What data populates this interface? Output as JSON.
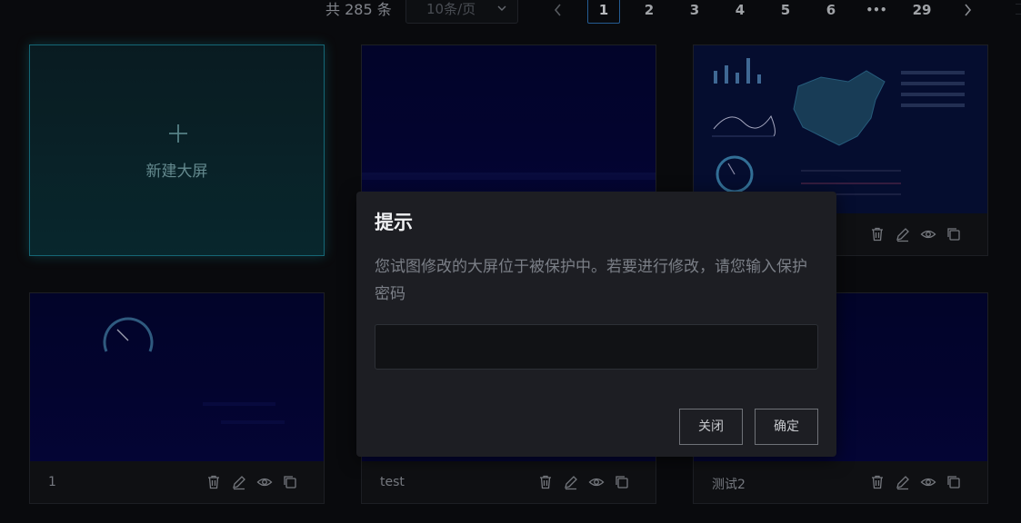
{
  "pagination": {
    "total_label": "共 285 条",
    "page_size": "10条/页",
    "pages": [
      "1",
      "2",
      "3",
      "4",
      "5",
      "6",
      "•••",
      "29"
    ],
    "current_page": "1"
  },
  "new_card": {
    "label": "新建大屏",
    "icon": "plus-icon"
  },
  "cards": [
    {
      "name": "",
      "thumbnail": "dark-blue-dashboard"
    },
    {
      "name": "",
      "thumbnail": "china-map-dashboard"
    },
    {
      "name": "1",
      "thumbnail": "gauge-dashboard"
    },
    {
      "name": "test",
      "thumbnail": "dark-blue-dashboard"
    },
    {
      "name": "测试2",
      "thumbnail": "dark-blue-dashboard"
    }
  ],
  "card_actions": [
    "delete-icon",
    "edit-icon",
    "preview-icon",
    "copy-icon"
  ],
  "dialog": {
    "title": "提示",
    "message": "您试图修改的大屏位于被保护中。若要进行修改，请您输入保护密码",
    "password_value": "",
    "cancel_label": "关闭",
    "confirm_label": "确定"
  },
  "colors": {
    "background": "#0c0d10",
    "accent": "#1a7d8f",
    "active_page": "#2d6fb3",
    "dialog_bg": "#1d1e23"
  }
}
